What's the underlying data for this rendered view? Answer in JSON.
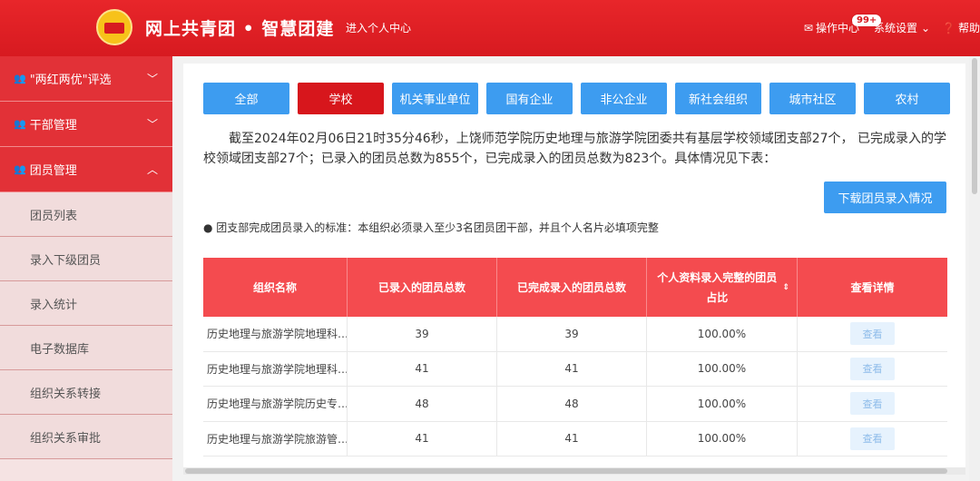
{
  "header": {
    "brand": "网上共青团 • 智慧团建",
    "center_link": "进入个人中心",
    "operation_center": "操作中心",
    "badge": "99+",
    "system_settings": "系统设置",
    "help": "帮助"
  },
  "sidebar": {
    "groups": [
      {
        "label": "\"两红两优\"评选",
        "expanded": false
      },
      {
        "label": "干部管理",
        "expanded": false
      },
      {
        "label": "团员管理",
        "expanded": true
      }
    ],
    "subitems": [
      "团员列表",
      "录入下级团员",
      "录入统计",
      "电子数据库",
      "组织关系转接",
      "组织关系审批"
    ]
  },
  "tabs": [
    {
      "label": "全部",
      "active": false
    },
    {
      "label": "学校",
      "active": true
    },
    {
      "label": "机关事业单位",
      "active": false
    },
    {
      "label": "国有企业",
      "active": false
    },
    {
      "label": "非公企业",
      "active": false
    },
    {
      "label": "新社会组织",
      "active": false
    },
    {
      "label": "城市社区",
      "active": false
    },
    {
      "label": "农村",
      "active": false
    }
  ],
  "summary": "截至2024年02月06日21时35分46秒，上饶师范学院历史地理与旅游学院团委共有基层学校领域团支部27个， 已完成录入的学校领域团支部27个；已录入的团员总数为855个，已完成录入的团员总数为823个。具体情况见下表：",
  "download_button": "下载团员录入情况",
  "note": "● 团支部完成团员录入的标准：本组织必须录入至少3名团员团干部，并且个人名片必填项完整",
  "table": {
    "headers": [
      "组织名称",
      "已录入的团员总数",
      "已完成录入的团员总数",
      "个人资料录入完整的团员占比",
      "查看详情"
    ],
    "rows": [
      {
        "name": "历史地理与旅游学院地理科…",
        "entered": "39",
        "completed": "39",
        "ratio": "100.00%",
        "action": "查看"
      },
      {
        "name": "历史地理与旅游学院地理科…",
        "entered": "41",
        "completed": "41",
        "ratio": "100.00%",
        "action": "查看"
      },
      {
        "name": "历史地理与旅游学院历史专…",
        "entered": "48",
        "completed": "48",
        "ratio": "100.00%",
        "action": "查看"
      },
      {
        "name": "历史地理与旅游学院旅游管…",
        "entered": "41",
        "completed": "41",
        "ratio": "100.00%",
        "action": "查看"
      }
    ]
  },
  "colors": {
    "header_red": "#d71a20",
    "tab_blue": "#3d9cf0",
    "tab_active_red": "#d7161c",
    "table_header_red": "#f44b4f"
  }
}
